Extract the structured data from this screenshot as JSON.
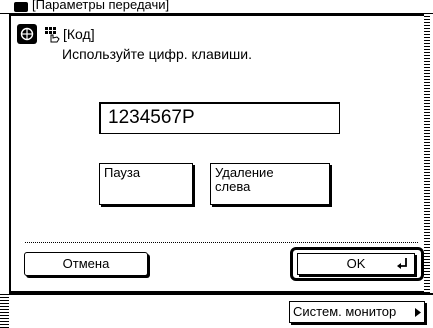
{
  "background_window": {
    "title": "[Параметры передачи]"
  },
  "dialog": {
    "title": "[Код]",
    "instruction": "Используйте цифр. клавиши.",
    "code_value": "1234567P",
    "pause_label": "Пауза",
    "delete_left_line1": "Удаление",
    "delete_left_line2": "слева",
    "cancel_label": "Отмена",
    "ok_label": "OK"
  },
  "system": {
    "monitor_label": "Систем. монитор"
  },
  "icons": {
    "header": "globe-icon",
    "key": "keypad-hand-icon",
    "enter": "enter-return-icon",
    "arrow": "arrow-right-icon"
  }
}
